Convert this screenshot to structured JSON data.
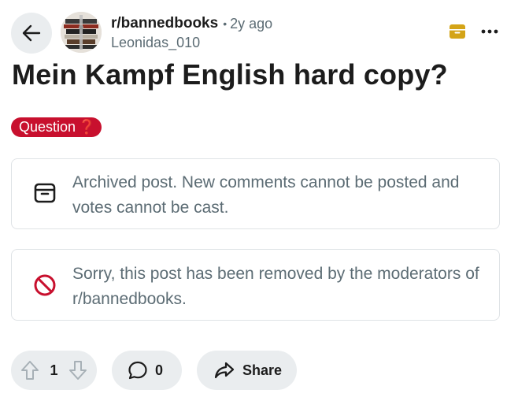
{
  "header": {
    "subreddit": "r/bannedbooks",
    "separator": "•",
    "age": "2y ago",
    "author": "Leonidas_010"
  },
  "post": {
    "title": "Mein Kampf English hard copy?",
    "flair": {
      "label": "Question",
      "emoji": "❓"
    }
  },
  "notices": {
    "archived": "Archived post. New comments cannot be posted and votes cannot be cast.",
    "removed": "Sorry, this post has been removed by the moderators of r/bannedbooks."
  },
  "actions": {
    "vote_count": "1",
    "comment_count": "0",
    "share_label": "Share"
  },
  "icons": {
    "back": "arrow-left-icon",
    "archive": "archive-box-icon",
    "more": "more-horizontal-icon",
    "removed": "ban-icon",
    "upvote": "upvote-arrow-icon",
    "downvote": "downvote-arrow-icon",
    "comment": "comment-bubble-icon",
    "share": "share-arrow-icon"
  },
  "colors": {
    "archive_accent": "#d4a417",
    "flair_background": "#c8102e",
    "removed_icon": "#c8102e",
    "pill_background": "#eaedef",
    "muted_text": "#5c6c74"
  }
}
